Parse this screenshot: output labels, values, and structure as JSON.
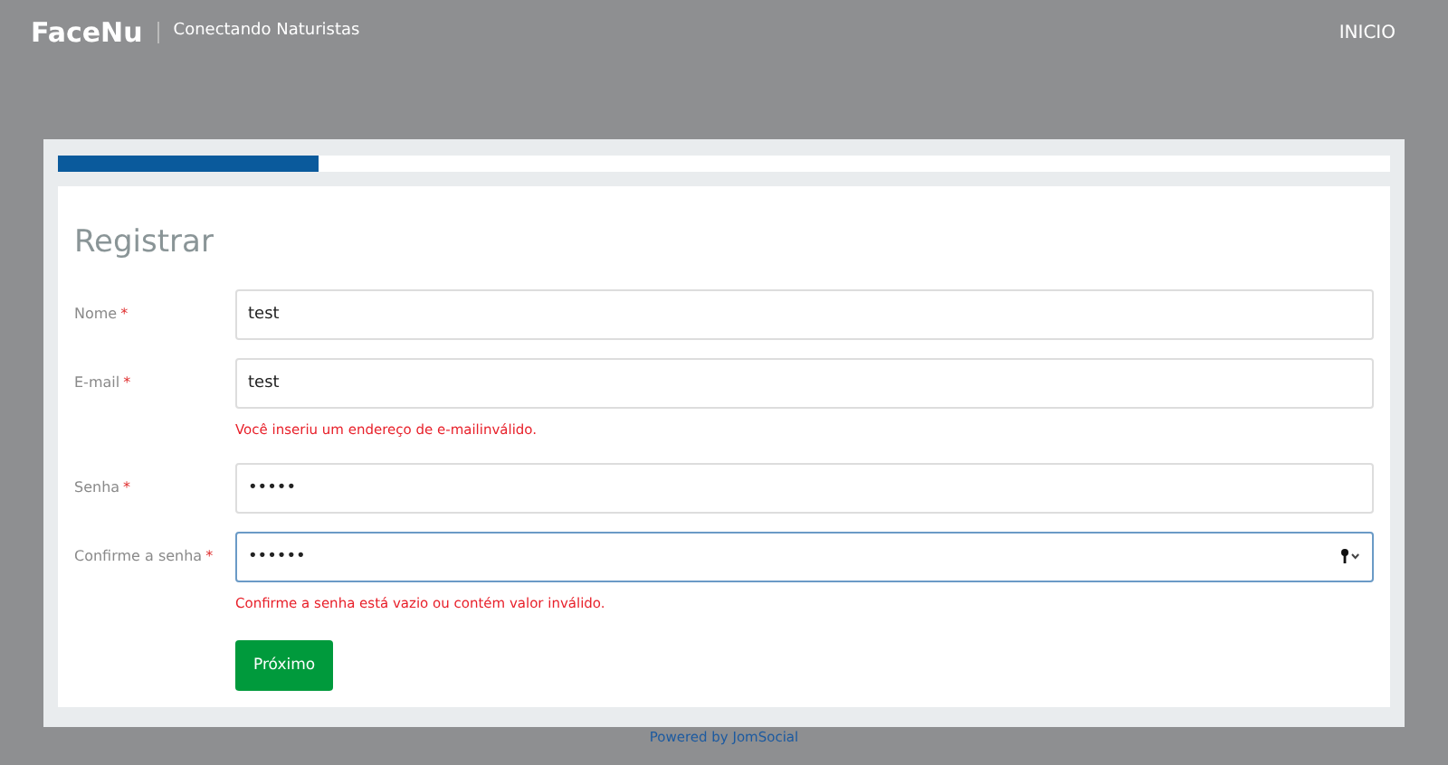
{
  "header": {
    "brand": "FaceNu",
    "tagline": "Conectando Naturistas",
    "nav": "INICIO"
  },
  "progress": {
    "level": 0.195
  },
  "form": {
    "title": "Registrar",
    "fields": [
      {
        "label": "Nome",
        "required": "*",
        "value": "test",
        "focused": false
      },
      {
        "label": "E-mail",
        "required": "*",
        "value": "test",
        "focused": false,
        "error": "Você inseriu um endereço de e-mailinválido."
      },
      {
        "label": "Senha",
        "required": "*",
        "value": "•••••",
        "focused": false
      },
      {
        "label": "Confirme a senha",
        "required": "*",
        "value": "••••••",
        "focused": true,
        "error": "Confirme a senha está vazio ou contém valor inválido."
      }
    ],
    "submit": "Próximo"
  },
  "footer": "Powered by JomSocial"
}
